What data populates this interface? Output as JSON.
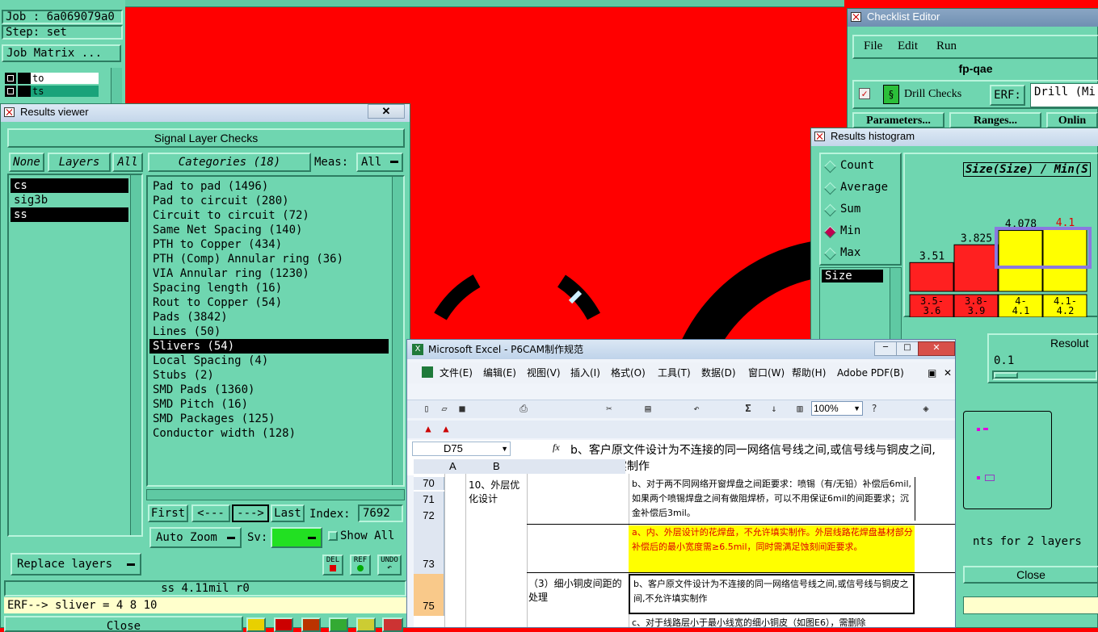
{
  "colors": {
    "teal": "#6fd6b0",
    "red": "#ff0000",
    "yellow": "#ffff00"
  },
  "topleft": {
    "job": "Job : 6a069079a0",
    "step": "Step: set",
    "job_matrix": "Job Matrix ...",
    "layers": [
      "to",
      "ts"
    ]
  },
  "results_viewer": {
    "title": "Results viewer",
    "header": "Signal Layer Checks",
    "none": "None",
    "layers": "Layers",
    "all": "All",
    "categories_label": "Categories (18)",
    "meas_label": "Meas:",
    "meas_value": "All",
    "layer_list": [
      "cs",
      "sig3b",
      "ss"
    ],
    "categories": [
      "Pad to pad (1496)",
      "Pad to circuit (280)",
      "Circuit to circuit (72)",
      "Same Net Spacing (140)",
      "PTH to Copper (434)",
      "PTH (Comp) Annular ring (36)",
      "VIA Annular ring (1230)",
      "Spacing length (16)",
      "Rout to Copper (54)",
      "Pads (3842)",
      "Lines (50)",
      "Slivers (54)",
      "Local Spacing (4)",
      "Stubs (2)",
      "SMD Pads (1360)",
      "SMD Pitch (16)",
      "SMD Packages (125)",
      "Conductor width (128)"
    ],
    "first": "First",
    "prev": "<---",
    "next": "--->",
    "last": "Last",
    "index_label": "Index:",
    "index_value": "7692",
    "auto_zoom": "Auto Zoom",
    "sv": "Sv:",
    "show_all": "Show All",
    "replace_layers": "Replace layers",
    "del": "DEL",
    "ref": "REF",
    "undo": "UNDO",
    "status": "ss 4.11mil  r0",
    "erf": "ERF--> sliver = 4 8 10",
    "close": "Close"
  },
  "checklist": {
    "title": "Checklist Editor",
    "menu": [
      "File",
      "Edit",
      "Run"
    ],
    "name": "fp-qae",
    "drill_checks": "Drill Checks",
    "erf_label": "ERF:",
    "erf_value": "Drill (Mi",
    "parameters": "Parameters...",
    "ranges": "Ranges...",
    "online": "Onlin"
  },
  "histogram": {
    "title": "Results histogram",
    "modes": [
      "Count",
      "Average",
      "Sum",
      "Min",
      "Max"
    ],
    "selected_mode": "Min",
    "size_label": "Size",
    "chart_title": "Size(Size) / Min(S",
    "bars": [
      {
        "label": "3.51",
        "range": "3.5-\n3.6",
        "value": 3.51,
        "color": "#ff2020"
      },
      {
        "label": "3.825",
        "range": "3.8-\n3.9",
        "value": 3.825,
        "color": "#ff2020"
      },
      {
        "label": "4.078",
        "range": "4-\n4.1",
        "value": 4.078,
        "color": "#ffff00"
      },
      {
        "label": "4.1",
        "range": "4.1-\n4.2",
        "value": 4.1,
        "color": "#ffff00"
      }
    ],
    "resolution_label": "Resolut",
    "resolution_value": "0.1",
    "points_text": "nts for 2 layers",
    "close": "Close"
  },
  "excel": {
    "title": "Microsoft Excel - P6CAM制作规范",
    "menu": [
      "文件(E)",
      "编辑(E)",
      "视图(V)",
      "插入(I)",
      "格式(O)",
      "工具(T)",
      "数据(D)",
      "窗口(W)",
      "帮助(H)",
      "Adobe PDF(B)"
    ],
    "zoom": "100%",
    "cellref": "D75",
    "fx": "fx",
    "formula": "b、客户原文件设计为不连接的同一网络信号线之间,或信号线与铜皮之间,不允许填实制作",
    "cols": [
      "A",
      "B"
    ],
    "rows": [
      "70",
      "71",
      "72",
      "73",
      "75"
    ],
    "b70": "10、外层优化设计",
    "d70": "b、对于两不同网络开窗焊盘之间距要求：喷锡（有/无铅）补偿后6mil,如果两个喷锡焊盘之间有做阻焊桥，可以不用保证6mil的间距要求；沉金补偿后3mil。",
    "d73": "a、内、外层设计的花焊盘，不允许填实制作。外层线路花焊盘基材部分补偿后的最小宽度需≥6.5mil，同时需满足蚀刻间距要求。",
    "b75": "（3）细小铜皮间距的处理",
    "d75": "b、客户原文件设计为不连接的同一网络信号线之间,或信号线与铜皮之间,不允许填实制作",
    "d76": "c、对于线路层小于最小线宽的细小铜皮（如图E6），需删除"
  }
}
